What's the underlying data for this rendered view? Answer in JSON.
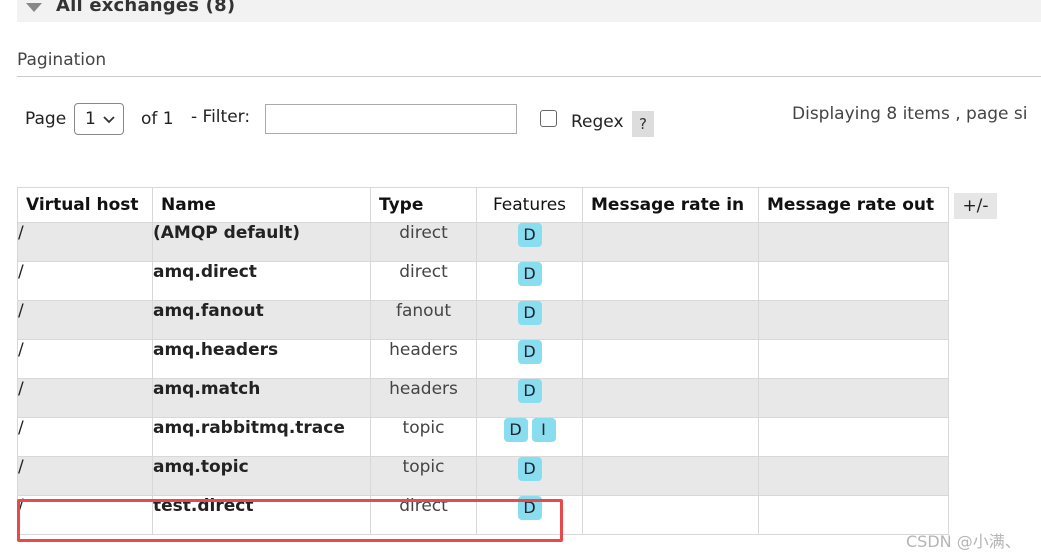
{
  "section": {
    "title": "All exchanges (8)"
  },
  "pagination": {
    "label": "Pagination",
    "page_label": "Page",
    "page_value": "1",
    "of_label": "of 1",
    "filter_label": "- Filter:",
    "filter_value": "",
    "regex_label": "Regex",
    "help_label": "?",
    "display_info": "Displaying 8 items , page si"
  },
  "table": {
    "headers": [
      "Virtual host",
      "Name",
      "Type",
      "Features",
      "Message rate in",
      "Message rate out"
    ],
    "toggle_label": "+/-",
    "rows": [
      {
        "vhost": "/",
        "name": "(AMQP default)",
        "type": "direct",
        "features": [
          "D"
        ]
      },
      {
        "vhost": "/",
        "name": "amq.direct",
        "type": "direct",
        "features": [
          "D"
        ]
      },
      {
        "vhost": "/",
        "name": "amq.fanout",
        "type": "fanout",
        "features": [
          "D"
        ]
      },
      {
        "vhost": "/",
        "name": "amq.headers",
        "type": "headers",
        "features": [
          "D"
        ]
      },
      {
        "vhost": "/",
        "name": "amq.match",
        "type": "headers",
        "features": [
          "D"
        ]
      },
      {
        "vhost": "/",
        "name": "amq.rabbitmq.trace",
        "type": "topic",
        "features": [
          "D",
          "I"
        ]
      },
      {
        "vhost": "/",
        "name": "amq.topic",
        "type": "topic",
        "features": [
          "D"
        ]
      },
      {
        "vhost": "/",
        "name": "test.direct",
        "type": "direct",
        "features": [
          "D"
        ]
      }
    ]
  },
  "colors": {
    "highlight": "#e84a4a",
    "badge": "#88ddee",
    "row_odd": "#e8e8e8"
  },
  "watermark": "CSDN @小满、"
}
